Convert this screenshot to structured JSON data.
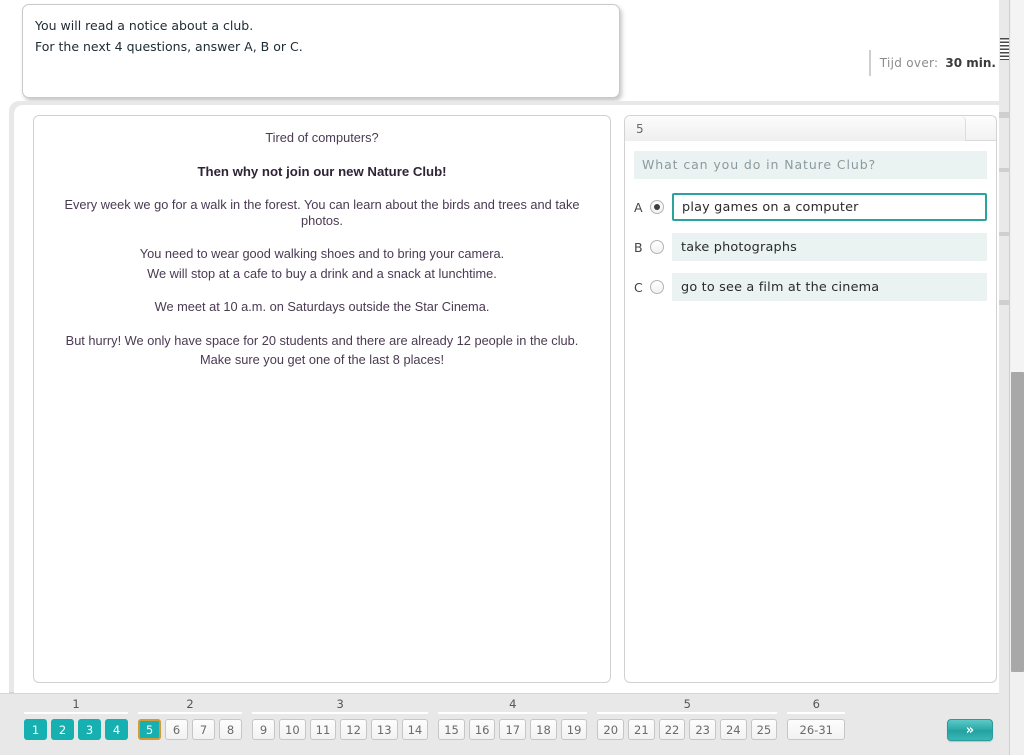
{
  "instructions": {
    "line1": "You will read a notice about a club.",
    "line2": "For the next 4 questions, answer A, B or C."
  },
  "timer": {
    "label": "Tijd over:",
    "value": "30 min."
  },
  "passage": {
    "hook": "Tired of computers?",
    "headline": "Then why not join our new Nature Club!",
    "para1": "Every week we go for a walk in the forest. You can learn about the birds and trees and take photos.",
    "para2_line1": "You need to wear good walking shoes and to bring your camera.",
    "para2_line2": "We will stop at a cafe to buy a drink and a snack at lunchtime.",
    "para3": "We meet at 10 a.m. on Saturdays outside the Star Cinema.",
    "para4_line1": "But hurry! We only have space for 20 students and there are already 12 people in the club.",
    "para4_line2": "Make sure you get one of the last 8 places!"
  },
  "question": {
    "number": "5",
    "prompt": "What can you do in Nature Club?",
    "options": [
      {
        "letter": "A",
        "text": "play games on a computer",
        "selected": true
      },
      {
        "letter": "B",
        "text": "take photographs",
        "selected": false
      },
      {
        "letter": "C",
        "text": "go to see a film at the cinema",
        "selected": false
      }
    ]
  },
  "navigation": {
    "groups": [
      {
        "label": "1",
        "items": [
          {
            "text": "1",
            "state": "done"
          },
          {
            "text": "2",
            "state": "done"
          },
          {
            "text": "3",
            "state": "done"
          },
          {
            "text": "4",
            "state": "done"
          }
        ]
      },
      {
        "label": "2",
        "items": [
          {
            "text": "5",
            "state": "current"
          },
          {
            "text": "6",
            "state": "idle"
          },
          {
            "text": "7",
            "state": "idle"
          },
          {
            "text": "8",
            "state": "idle"
          }
        ]
      },
      {
        "label": "3",
        "items": [
          {
            "text": "9",
            "state": "idle"
          },
          {
            "text": "10",
            "state": "idle"
          },
          {
            "text": "11",
            "state": "idle"
          },
          {
            "text": "12",
            "state": "idle"
          },
          {
            "text": "13",
            "state": "idle"
          },
          {
            "text": "14",
            "state": "idle"
          }
        ]
      },
      {
        "label": "4",
        "items": [
          {
            "text": "15",
            "state": "idle"
          },
          {
            "text": "16",
            "state": "idle"
          },
          {
            "text": "17",
            "state": "idle"
          },
          {
            "text": "18",
            "state": "idle"
          },
          {
            "text": "19",
            "state": "idle"
          }
        ]
      },
      {
        "label": "5",
        "items": [
          {
            "text": "20",
            "state": "idle"
          },
          {
            "text": "21",
            "state": "idle"
          },
          {
            "text": "22",
            "state": "idle"
          },
          {
            "text": "23",
            "state": "idle"
          },
          {
            "text": "24",
            "state": "idle"
          },
          {
            "text": "25",
            "state": "idle"
          }
        ]
      },
      {
        "label": "6",
        "items": [
          {
            "text": "26-31",
            "state": "idle",
            "wide": true
          }
        ]
      }
    ],
    "next_label": "»"
  },
  "colors": {
    "teal": "#17b0b0",
    "teal_border": "#2aa3a0",
    "current_outline": "#d49a33",
    "option_bg": "#eaf3f1",
    "passage_text": "#4a3a52"
  }
}
